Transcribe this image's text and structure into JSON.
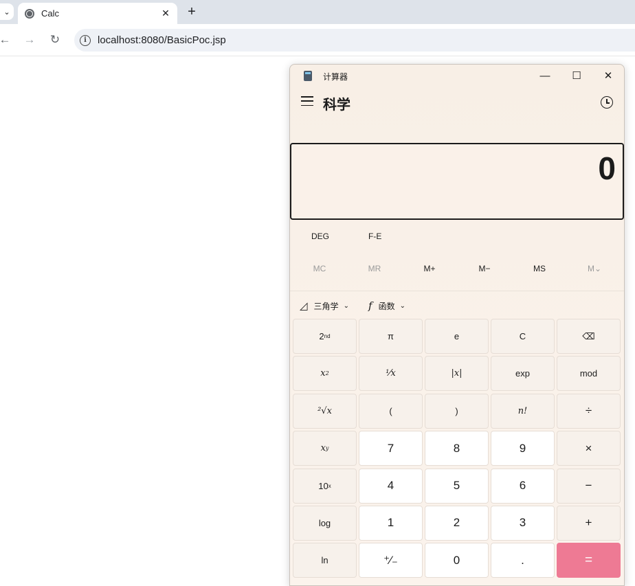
{
  "browser": {
    "tab_title": "Calc",
    "tab_close": "✕",
    "new_tab": "+",
    "url": "localhost:8080/BasicPoc.jsp",
    "back": "←",
    "forward": "→",
    "reload": "↻",
    "tab_list": "⌄"
  },
  "calculator": {
    "window_title": "计算器",
    "minimize": "—",
    "maximize": "☐",
    "close": "✕",
    "mode": "科学",
    "display": "0",
    "angle_mode": "DEG",
    "fe_label": "F-E",
    "memory": [
      {
        "label": "MC",
        "enabled": false
      },
      {
        "label": "MR",
        "enabled": false
      },
      {
        "label": "M+",
        "enabled": true
      },
      {
        "label": "M−",
        "enabled": true
      },
      {
        "label": "MS",
        "enabled": true
      },
      {
        "label": "M⌄",
        "enabled": false
      }
    ],
    "trig_label": "三角学",
    "func_label": "函数",
    "func_icon": "𝑓",
    "trig_icon": "◿",
    "chevron": "⌄",
    "keys": {
      "second": "2",
      "second_sup": "nd",
      "pi": "π",
      "e": "e",
      "clear": "C",
      "backspace": "⌫",
      "square": "x",
      "square_sup": "2",
      "reciprocal": "¹⁄x",
      "abs": "|x|",
      "exp": "exp",
      "mod": "mod",
      "root": "²√x",
      "lparen": "(",
      "rparen": ")",
      "factorial": "n!",
      "divide": "÷",
      "power": "x",
      "power_sup": "y",
      "seven": "7",
      "eight": "8",
      "nine": "9",
      "multiply": "×",
      "ten_power": "10",
      "ten_power_sup": "x",
      "four": "4",
      "five": "5",
      "six": "6",
      "minus": "−",
      "log": "log",
      "one": "1",
      "two": "2",
      "three": "3",
      "plus": "+",
      "ln": "ln",
      "negate": "⁺⁄₋",
      "zero": "0",
      "decimal": ".",
      "equals": "="
    }
  }
}
